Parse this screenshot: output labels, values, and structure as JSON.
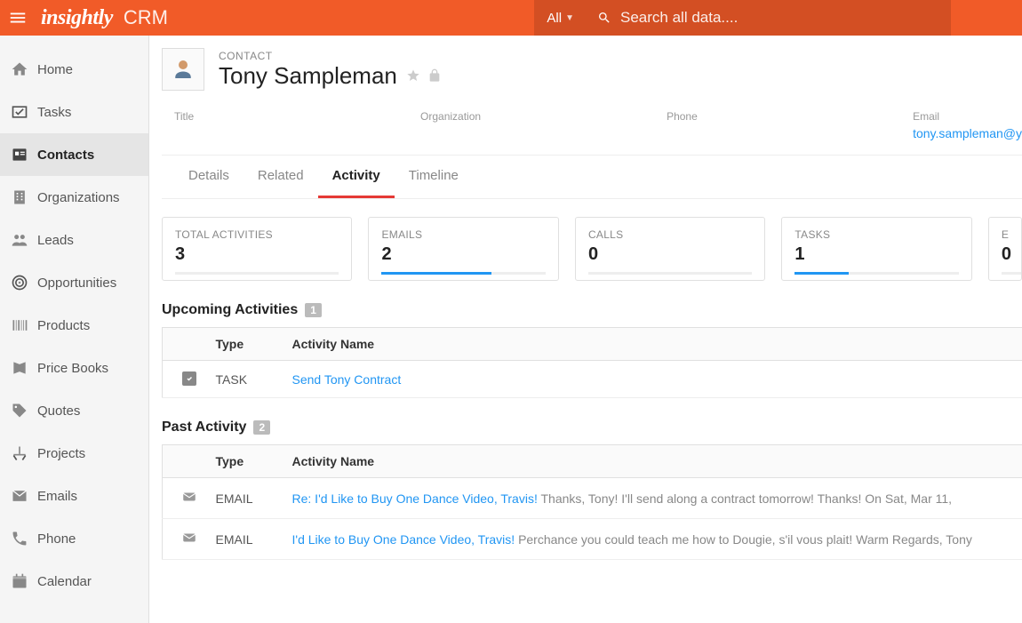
{
  "brand": {
    "logo_text": "insightly",
    "product": "CRM"
  },
  "topbar": {
    "filter_label": "All",
    "search_placeholder": "Search all data...."
  },
  "sidebar": {
    "items": [
      {
        "label": "Home",
        "icon": "home"
      },
      {
        "label": "Tasks",
        "icon": "check"
      },
      {
        "label": "Contacts",
        "icon": "contacts",
        "active": true
      },
      {
        "label": "Organizations",
        "icon": "building"
      },
      {
        "label": "Leads",
        "icon": "leads"
      },
      {
        "label": "Opportunities",
        "icon": "target"
      },
      {
        "label": "Products",
        "icon": "barcode"
      },
      {
        "label": "Price Books",
        "icon": "book"
      },
      {
        "label": "Quotes",
        "icon": "tag"
      },
      {
        "label": "Projects",
        "icon": "projects"
      },
      {
        "label": "Emails",
        "icon": "mail"
      },
      {
        "label": "Phone",
        "icon": "phone"
      },
      {
        "label": "Calendar",
        "icon": "calendar"
      }
    ]
  },
  "contact": {
    "kicker": "CONTACT",
    "name": "Tony Sampleman",
    "fields": {
      "title_label": "Title",
      "title_value": "",
      "org_label": "Organization",
      "org_value": "",
      "phone_label": "Phone",
      "phone_value": "",
      "email_label": "Email",
      "email_value": "tony.sampleman@y"
    }
  },
  "tabs": [
    {
      "label": "Details"
    },
    {
      "label": "Related"
    },
    {
      "label": "Activity",
      "active": true
    },
    {
      "label": "Timeline"
    }
  ],
  "stats": [
    {
      "label": "TOTAL ACTIVITIES",
      "value": "3",
      "progress": 0
    },
    {
      "label": "EMAILS",
      "value": "2",
      "progress": 67
    },
    {
      "label": "CALLS",
      "value": "0",
      "progress": 0
    },
    {
      "label": "TASKS",
      "value": "1",
      "progress": 33
    },
    {
      "label": "E",
      "value": "0",
      "progress": 0
    }
  ],
  "upcoming": {
    "title": "Upcoming Activities",
    "count": "1",
    "headers": {
      "type": "Type",
      "name": "Activity Name"
    },
    "rows": [
      {
        "icon": "checkbox",
        "type": "TASK",
        "name": "Send Tony Contract"
      }
    ]
  },
  "past": {
    "title": "Past Activity",
    "count": "2",
    "headers": {
      "type": "Type",
      "name": "Activity Name"
    },
    "rows": [
      {
        "icon": "mail",
        "type": "EMAIL",
        "name": "Re: I'd Like to Buy One Dance Video, Travis!",
        "snippet": "Thanks, Tony! I'll send along a contract tomorrow! Thanks! On Sat, Mar 11,"
      },
      {
        "icon": "mail",
        "type": "EMAIL",
        "name": "I'd Like to Buy One Dance Video, Travis!",
        "snippet": "Perchance you could teach me how to Dougie, s'il vous plait! Warm Regards, Tony"
      }
    ]
  }
}
